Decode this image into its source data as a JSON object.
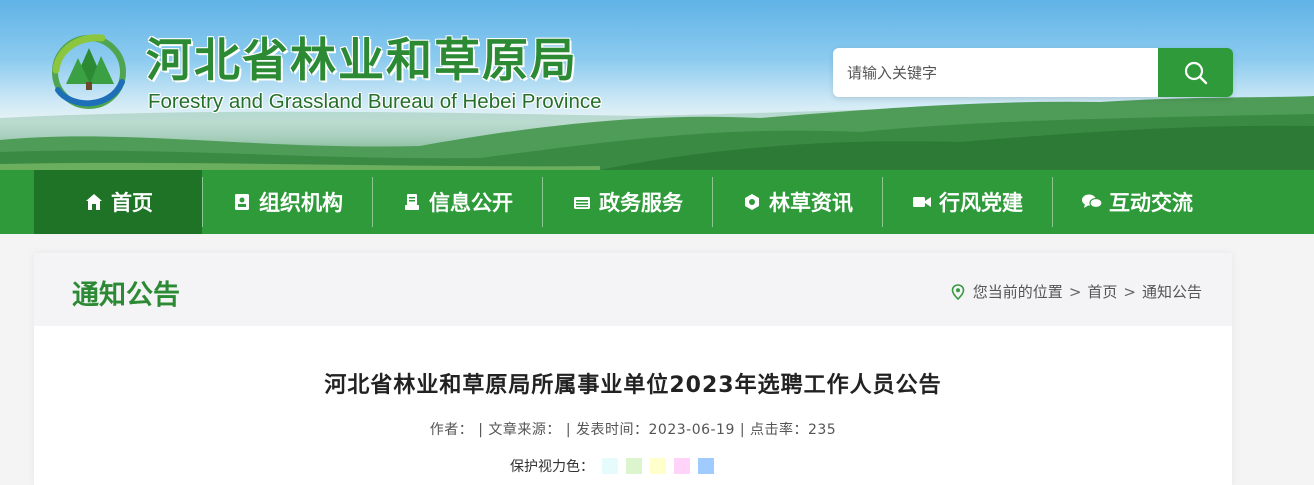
{
  "header": {
    "title": "河北省林业和草原局",
    "subtitle": "Forestry and Grassland Bureau of Hebei Province",
    "logo_icon": "forest-bureau-logo-icon"
  },
  "search": {
    "placeholder": "请输入关键字",
    "button_icon": "search-icon"
  },
  "nav": {
    "items": [
      {
        "label": "首页",
        "icon": "home-icon",
        "active": true
      },
      {
        "label": "组织机构",
        "icon": "org-icon"
      },
      {
        "label": "信息公开",
        "icon": "document-icon"
      },
      {
        "label": "政务服务",
        "icon": "service-icon"
      },
      {
        "label": "林草资讯",
        "icon": "news-icon"
      },
      {
        "label": "行风党建",
        "icon": "camera-icon"
      },
      {
        "label": "互动交流",
        "icon": "chat-icon"
      }
    ]
  },
  "section": {
    "title": "通知公告"
  },
  "breadcrumb": {
    "prefix": "您当前的位置",
    "separator": ">",
    "items": [
      "首页",
      "通知公告"
    ]
  },
  "article": {
    "title": "河北省林业和草原局所属事业单位2023年选聘工作人员公告",
    "meta": "作者：  | 文章来源：  | 发表时间：2023-06-19 | 点击率：235",
    "eye_label": "保护视力色：",
    "eye_colors": [
      "#e6fcfc",
      "#ddf5cf",
      "#ffffcc",
      "#ffd4f8",
      "#9fcbff"
    ]
  }
}
